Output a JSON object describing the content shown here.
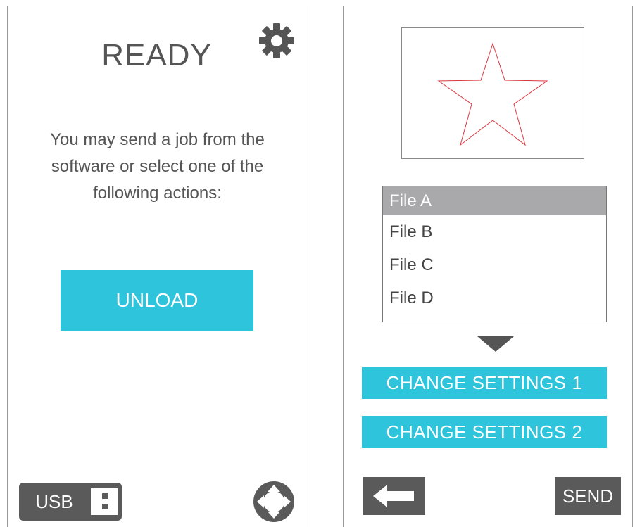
{
  "left_panel": {
    "title": "READY",
    "message": "You may send a job from the software or select one of the following actions:",
    "unload_label": "UNLOAD",
    "usb_label": "USB",
    "icons": {
      "settings": "gear-icon",
      "usb_connector": "usb-connector-icon",
      "navigation": "dpad-icon"
    }
  },
  "right_panel": {
    "preview_shape": "star",
    "files": [
      {
        "label": "File A",
        "selected": true
      },
      {
        "label": "File B",
        "selected": false
      },
      {
        "label": "File C",
        "selected": false
      },
      {
        "label": "File D",
        "selected": false
      }
    ],
    "change_settings_1_label": "CHANGE SETTINGS 1",
    "change_settings_2_label": "CHANGE SETTINGS 2",
    "send_label": "SEND",
    "icons": {
      "more_files": "chevron-down-icon",
      "back": "back-arrow-icon"
    }
  },
  "colors": {
    "accent": "#2ec4dc",
    "dark": "#5a5a5a",
    "text": "#555555",
    "selected_row": "#a9a9ab",
    "star_stroke": "#d9363e"
  }
}
